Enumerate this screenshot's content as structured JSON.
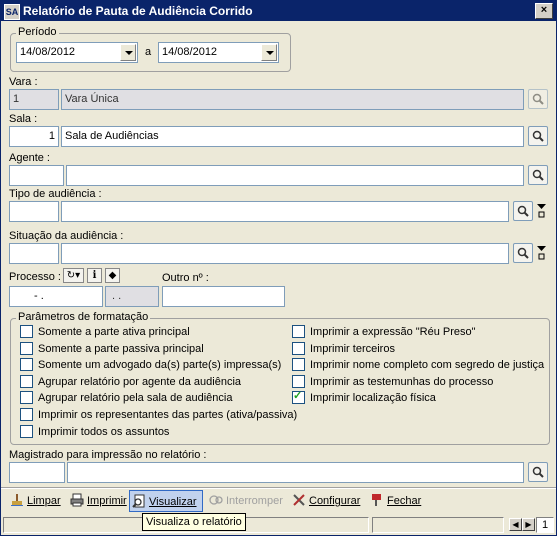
{
  "window": {
    "title": "Relatório de Pauta de Audiência Corrido",
    "close_glyph": "×"
  },
  "periodo": {
    "label": "Período",
    "start_value": "14/08/2012",
    "separator": "a",
    "end_value": "14/08/2012"
  },
  "vara": {
    "label": "Vara :",
    "code": "1",
    "name": "Vara Única"
  },
  "sala": {
    "label": "Sala :",
    "code": "1",
    "name": "Sala de Audiências"
  },
  "agente": {
    "label": "Agente :",
    "code": "",
    "name": ""
  },
  "tipo": {
    "label": "Tipo de audiência :",
    "code": "",
    "name": ""
  },
  "situacao": {
    "label": "Situação da audiência :",
    "code": "",
    "name": ""
  },
  "processo": {
    "label": "Processo :",
    "value": " - .",
    "value2": ". .",
    "outro_label": "Outro nº :",
    "outro_value": ""
  },
  "formatacao": {
    "title": "Parâmetros de formatação",
    "left": [
      {
        "label": "Somente a parte ativa principal",
        "checked": false
      },
      {
        "label": "Somente a parte passiva principal",
        "checked": false
      },
      {
        "label": "Somente um advogado da(s) parte(s) impressa(s)",
        "checked": false
      },
      {
        "label": "Agrupar relatório por agente da audiência",
        "checked": false
      },
      {
        "label": "Agrupar relatório pela sala de audiência",
        "checked": false
      },
      {
        "label": "Imprimir os representantes das partes (ativa/passiva)",
        "checked": false
      },
      {
        "label": "Imprimir todos os assuntos",
        "checked": false
      }
    ],
    "right": [
      {
        "label": "Imprimir a expressão \"Réu Preso\"",
        "checked": false
      },
      {
        "label": "Imprimir terceiros",
        "checked": false
      },
      {
        "label": "Imprimir nome completo com segredo de justiça",
        "checked": false
      },
      {
        "label": "Imprimir as testemunhas do processo",
        "checked": false
      },
      {
        "label": "Imprimir localização física",
        "checked": true
      }
    ]
  },
  "magistrado": {
    "label": "Magistrado para impressão no relatório :",
    "code": "",
    "name": ""
  },
  "toolbar": {
    "limpar": "Limpar",
    "imprimir": "Imprimir",
    "visualizar": "Visualizar",
    "interromper": "Interromper",
    "configurar": "Configurar",
    "fechar": "Fechar"
  },
  "tooltip": "Visualiza o relatório",
  "status": {
    "page": "1"
  }
}
